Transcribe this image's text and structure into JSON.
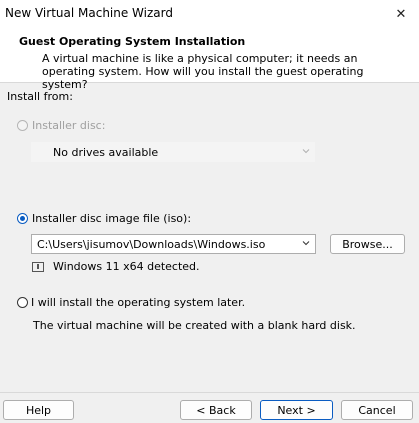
{
  "window": {
    "title": "New Virtual Machine Wizard",
    "close_glyph": "✕"
  },
  "header": {
    "title": "Guest Operating System Installation",
    "description": "A virtual machine is like a physical computer; it needs an operating system. How will you install the guest operating system?"
  },
  "install_from_label": "Install from:",
  "options": {
    "installer_disc": {
      "label": "Installer disc:",
      "selected": false,
      "enabled": false,
      "drive_value": "No drives available"
    },
    "iso": {
      "label": "Installer disc image file (iso):",
      "selected": true,
      "path": "C:\\Users\\jisumov\\Downloads\\Windows.iso",
      "browse_label": "Browse...",
      "detected": "Windows 11 x64 detected."
    },
    "later": {
      "label": "I will install the operating system later.",
      "selected": false,
      "note": "The virtual machine will be created with a blank hard disk."
    }
  },
  "buttons": {
    "help": "Help",
    "back": "< Back",
    "next": "Next >",
    "cancel": "Cancel"
  },
  "colors": {
    "accent": "#0a5cc2",
    "background": "#f0f0f0",
    "header_bg": "#ffffff",
    "disabled_text": "#a0a0a0"
  }
}
